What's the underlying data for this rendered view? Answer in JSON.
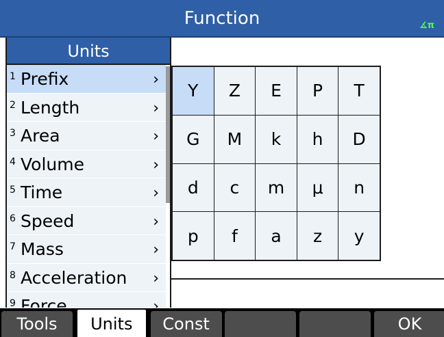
{
  "titlebar": {
    "title": "Function",
    "angle_indicator": "∡π"
  },
  "menu": {
    "header": "Units",
    "items": [
      {
        "num": "1",
        "label": "Prefix",
        "arrow": "›"
      },
      {
        "num": "2",
        "label": "Length",
        "arrow": "›"
      },
      {
        "num": "3",
        "label": "Area",
        "arrow": "›"
      },
      {
        "num": "4",
        "label": "Volume",
        "arrow": "›"
      },
      {
        "num": "5",
        "label": "Time",
        "arrow": "›"
      },
      {
        "num": "6",
        "label": "Speed",
        "arrow": "›"
      },
      {
        "num": "7",
        "label": "Mass",
        "arrow": "›"
      },
      {
        "num": "8",
        "label": "Acceleration",
        "arrow": "›"
      },
      {
        "num": "9",
        "label": "Force",
        "arrow": "›"
      }
    ],
    "selected_index": 0
  },
  "prefix_grid": {
    "cells": [
      "Y",
      "Z",
      "E",
      "P",
      "T",
      "G",
      "M",
      "k",
      "h",
      "D",
      "d",
      "c",
      "m",
      "μ",
      "n",
      "p",
      "f",
      "a",
      "z",
      "y"
    ],
    "selected_index": 0
  },
  "softkeys": [
    {
      "label": "Tools",
      "active": false
    },
    {
      "label": "Units",
      "active": true
    },
    {
      "label": "Const",
      "active": false
    },
    {
      "label": "",
      "active": false
    },
    {
      "label": "",
      "active": false
    },
    {
      "label": "OK",
      "active": false
    }
  ],
  "colors": {
    "titlebar": "#2f5fa6",
    "selection": "#c6dcf7",
    "item_bg": "#edf3f6",
    "angle_indicator": "#4cff4c"
  }
}
